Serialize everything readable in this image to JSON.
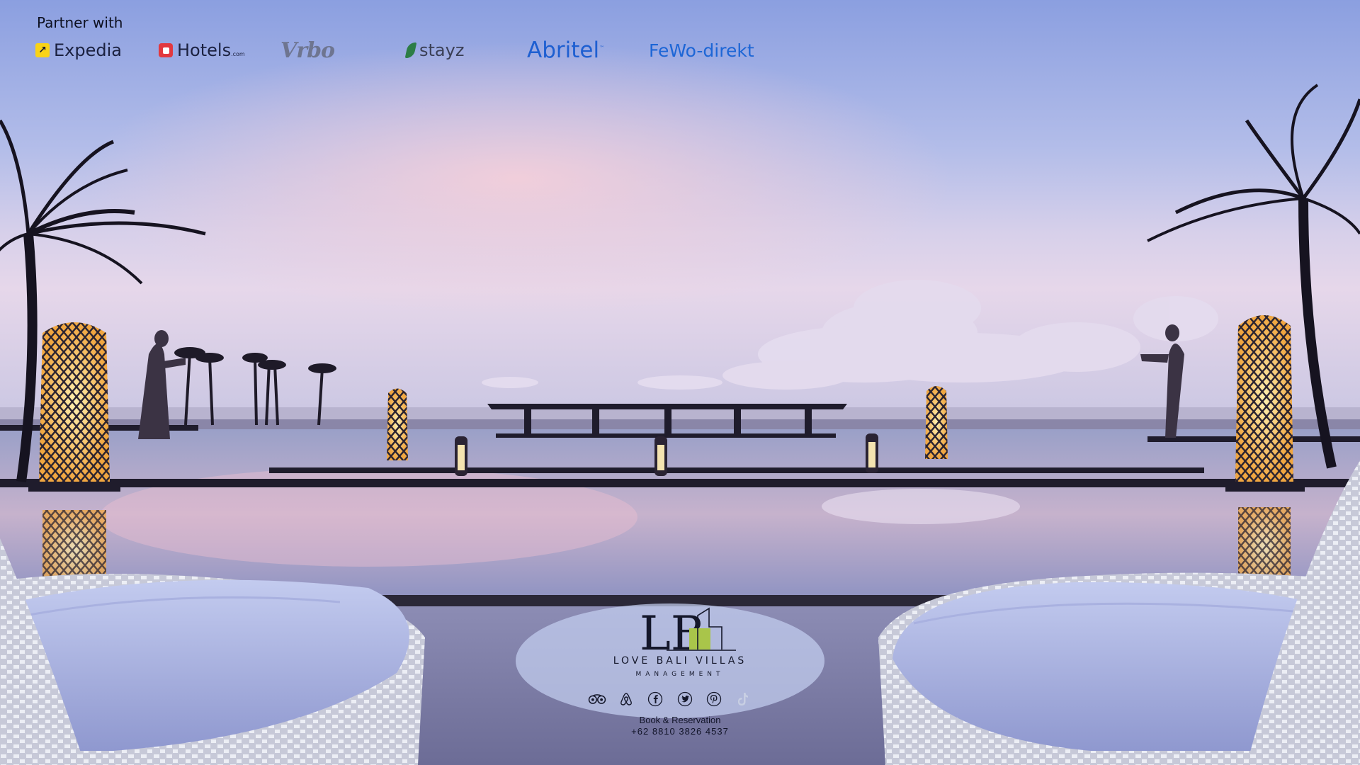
{
  "partners": {
    "title": "Partner with",
    "items": [
      {
        "label": "Expedia",
        "icon": "expedia-arrow-icon"
      },
      {
        "label": "Hotels",
        "suffix": ".com",
        "icon": "hotels-square-icon"
      },
      {
        "label": "Vrbo"
      },
      {
        "label": "stayz",
        "icon": "stayz-leaf-icon"
      },
      {
        "label": "Abritel",
        "mark": "™"
      },
      {
        "label": "FeWo-direkt"
      }
    ]
  },
  "brand": {
    "monogram": "LB",
    "name": "LOVE BALI VILLAS",
    "subtitle": "MANAGEMENT",
    "accent_color": "#a9c54a",
    "social_icons": [
      "tripadvisor-icon",
      "airbnb-icon",
      "facebook-icon",
      "twitter-icon",
      "pinterest-icon",
      "tiktok-icon"
    ],
    "book_label": "Book & Reservation",
    "phone": "+62 8810 3826 4537"
  },
  "colors": {
    "sky_top": "#8b9fe0",
    "sky_glow": "#f2c8d8",
    "lantern_glow": "#ffd47a",
    "expedia_yellow": "#f9d316",
    "hotels_red": "#e2383f",
    "abritel_blue": "#1e5fd1"
  }
}
